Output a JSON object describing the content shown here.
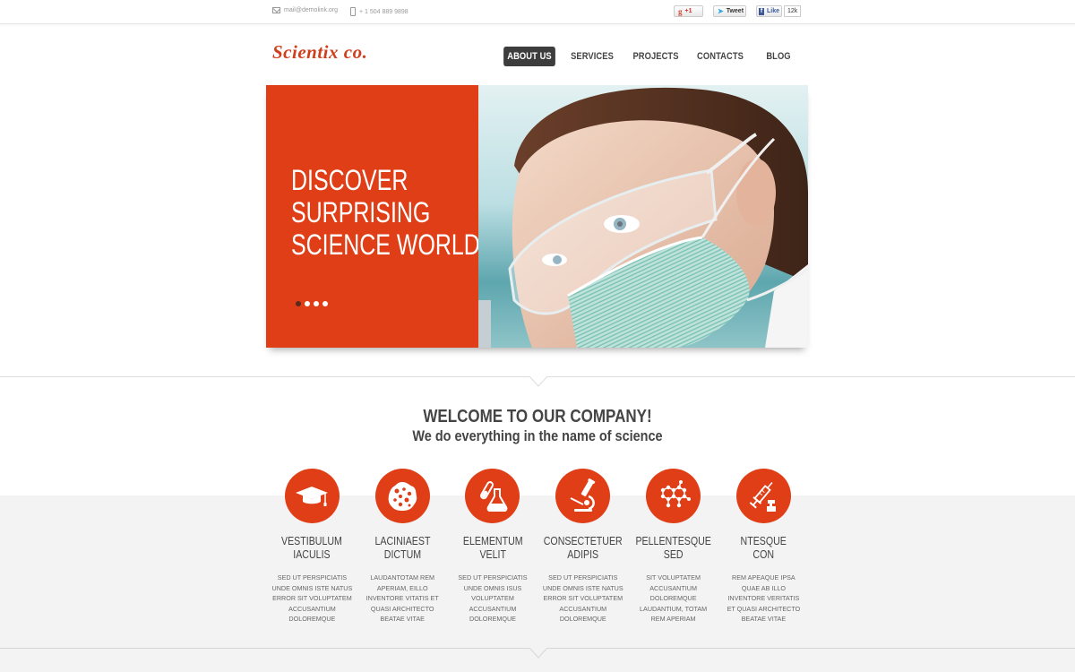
{
  "topbar": {
    "email": "mail@demolink.org",
    "phone": "+ 1 504 889 9898",
    "social": {
      "gplus_label": "+1",
      "tweet_label": "Tweet",
      "like_label": "Like",
      "like_count": "12k"
    }
  },
  "header": {
    "logo": "Scientix co.",
    "nav": [
      {
        "label": "About Us",
        "active": true
      },
      {
        "label": "Services",
        "active": false
      },
      {
        "label": "Projects",
        "active": false
      },
      {
        "label": "Contacts",
        "active": false
      },
      {
        "label": "Blog",
        "active": false
      }
    ]
  },
  "hero": {
    "title_lines": [
      "DISCOVER",
      "SURPRISING",
      "SCIENCE WORLD!"
    ],
    "slide_count": 4,
    "active_slide": 1,
    "image_alt": "Scientist wearing safety goggles and surgical mask"
  },
  "welcome": {
    "title": "WELCOME TO OUR COMPANY!",
    "subtitle": "We do everything in the name of science"
  },
  "features": [
    {
      "icon": "graduation-cap-icon",
      "title": [
        "Vestibulum",
        "Iaculis"
      ],
      "text": [
        "Sed ut perspiciatis",
        "unde omnis iste natus",
        "error sit voluptatem",
        "accusantium",
        "doloremque"
      ]
    },
    {
      "icon": "cell-icon",
      "title": [
        "Laciniaest",
        "Dictum"
      ],
      "text": [
        "Laudantotam rem",
        "aperiam, eillo",
        "inventore vitatis et",
        "quasi architecto",
        "beatae vitae"
      ]
    },
    {
      "icon": "flask-icon",
      "title": [
        "Elementum",
        "Velit"
      ],
      "text": [
        "Sed ut perspiciatis",
        "unde omnis isus",
        "voluptatem",
        "accusantium",
        "doloremque"
      ]
    },
    {
      "icon": "microscope-icon",
      "title": [
        "Consectetuer",
        "Adipis"
      ],
      "text": [
        "Sed ut perspiciatis",
        "unde omnis iste natus",
        "error sit voluptatem",
        "accusantium",
        "doloremque"
      ]
    },
    {
      "icon": "molecule-icon",
      "title": [
        "Pellentesque",
        "Sed"
      ],
      "text": [
        "Sit voluptatem",
        "accusantium",
        "doloremque",
        "laudantium, totam",
        "rem aperiam"
      ]
    },
    {
      "icon": "syringe-icon",
      "title": [
        "Ntesque",
        "Con"
      ],
      "text": [
        "Rem apeaque ipsa",
        "quae ab illo",
        "inventore veritatis",
        "et quasi architecto",
        "beatae vitae"
      ]
    }
  ],
  "colors": {
    "accent": "#df3e17",
    "nav_active_bg": "#3d3d3d",
    "text": "#444444",
    "band_bg": "#f3f3f3"
  }
}
